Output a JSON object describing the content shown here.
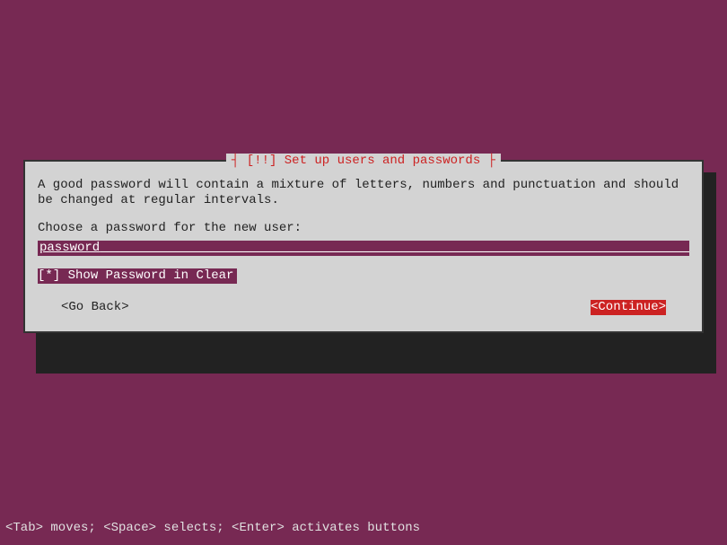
{
  "dialog": {
    "title": "[!!] Set up users and passwords",
    "description": "A good password will contain a mixture of letters, numbers and punctuation and should be changed at regular intervals.",
    "prompt": "Choose a password for the new user:",
    "password_value": "password",
    "checkbox": {
      "mark": "[*]",
      "label": "Show Password in Clear"
    },
    "buttons": {
      "back": "<Go Back>",
      "continue": "<Continue>"
    }
  },
  "footer": "<Tab> moves; <Space> selects; <Enter> activates buttons"
}
